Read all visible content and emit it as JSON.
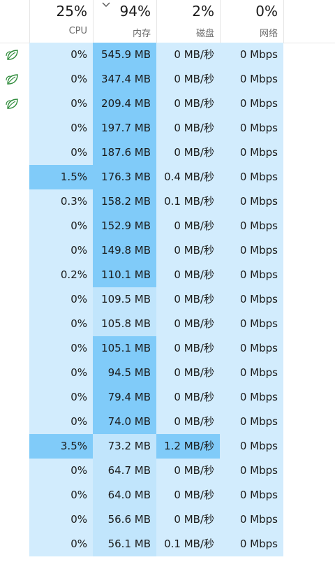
{
  "header": {
    "columns": [
      {
        "percent": "25%",
        "label": "CPU"
      },
      {
        "percent": "94%",
        "label": "内存",
        "sorted": true,
        "sort_icon": "chevron-down-icon"
      },
      {
        "percent": "2%",
        "label": "磁盘"
      },
      {
        "percent": "0%",
        "label": "网络"
      }
    ]
  },
  "heat_colors": {
    "l1": "#d2ecfd",
    "l2": "#c1e5fc",
    "l3": "#9cd6fb",
    "l4": "#80cbf9"
  },
  "rows": [
    {
      "efficiency_icon": "leaf-icon",
      "cpu": "0%",
      "cpu_lvl": "l1",
      "mem": "545.9 MB",
      "mem_lvl": "l4",
      "disk": "0 MB/秒",
      "disk_lvl": "l1",
      "net": "0 Mbps",
      "net_lvl": "l1"
    },
    {
      "efficiency_icon": "leaf-icon",
      "cpu": "0%",
      "cpu_lvl": "l1",
      "mem": "347.4 MB",
      "mem_lvl": "l4",
      "disk": "0 MB/秒",
      "disk_lvl": "l1",
      "net": "0 Mbps",
      "net_lvl": "l1"
    },
    {
      "efficiency_icon": "leaf-icon",
      "cpu": "0%",
      "cpu_lvl": "l1",
      "mem": "209.4 MB",
      "mem_lvl": "l4",
      "disk": "0 MB/秒",
      "disk_lvl": "l1",
      "net": "0 Mbps",
      "net_lvl": "l1"
    },
    {
      "cpu": "0%",
      "cpu_lvl": "l1",
      "mem": "197.7 MB",
      "mem_lvl": "l4",
      "disk": "0 MB/秒",
      "disk_lvl": "l1",
      "net": "0 Mbps",
      "net_lvl": "l1"
    },
    {
      "cpu": "0%",
      "cpu_lvl": "l1",
      "mem": "187.6 MB",
      "mem_lvl": "l4",
      "disk": "0 MB/秒",
      "disk_lvl": "l1",
      "net": "0 Mbps",
      "net_lvl": "l1"
    },
    {
      "cpu": "1.5%",
      "cpu_lvl": "l4",
      "mem": "176.3 MB",
      "mem_lvl": "l4",
      "disk": "0.4 MB/秒",
      "disk_lvl": "l1",
      "net": "0 Mbps",
      "net_lvl": "l1"
    },
    {
      "cpu": "0.3%",
      "cpu_lvl": "l1",
      "mem": "158.2 MB",
      "mem_lvl": "l4",
      "disk": "0.1 MB/秒",
      "disk_lvl": "l1",
      "net": "0 Mbps",
      "net_lvl": "l1"
    },
    {
      "cpu": "0%",
      "cpu_lvl": "l1",
      "mem": "152.9 MB",
      "mem_lvl": "l4",
      "disk": "0 MB/秒",
      "disk_lvl": "l1",
      "net": "0 Mbps",
      "net_lvl": "l1"
    },
    {
      "cpu": "0%",
      "cpu_lvl": "l1",
      "mem": "149.8 MB",
      "mem_lvl": "l4",
      "disk": "0 MB/秒",
      "disk_lvl": "l1",
      "net": "0 Mbps",
      "net_lvl": "l1"
    },
    {
      "cpu": "0.2%",
      "cpu_lvl": "l1",
      "mem": "110.1 MB",
      "mem_lvl": "l4",
      "disk": "0 MB/秒",
      "disk_lvl": "l1",
      "net": "0 Mbps",
      "net_lvl": "l1"
    },
    {
      "cpu": "0%",
      "cpu_lvl": "l1",
      "mem": "109.5 MB",
      "mem_lvl": "l2",
      "disk": "0 MB/秒",
      "disk_lvl": "l1",
      "net": "0 Mbps",
      "net_lvl": "l1"
    },
    {
      "cpu": "0%",
      "cpu_lvl": "l1",
      "mem": "105.8 MB",
      "mem_lvl": "l2",
      "disk": "0 MB/秒",
      "disk_lvl": "l1",
      "net": "0 Mbps",
      "net_lvl": "l1"
    },
    {
      "cpu": "0%",
      "cpu_lvl": "l1",
      "mem": "105.1 MB",
      "mem_lvl": "l4",
      "disk": "0 MB/秒",
      "disk_lvl": "l1",
      "net": "0 Mbps",
      "net_lvl": "l1"
    },
    {
      "cpu": "0%",
      "cpu_lvl": "l1",
      "mem": "94.5 MB",
      "mem_lvl": "l4",
      "disk": "0 MB/秒",
      "disk_lvl": "l1",
      "net": "0 Mbps",
      "net_lvl": "l1"
    },
    {
      "cpu": "0%",
      "cpu_lvl": "l1",
      "mem": "79.4 MB",
      "mem_lvl": "l4",
      "disk": "0 MB/秒",
      "disk_lvl": "l1",
      "net": "0 Mbps",
      "net_lvl": "l1"
    },
    {
      "cpu": "0%",
      "cpu_lvl": "l1",
      "mem": "74.0 MB",
      "mem_lvl": "l4",
      "disk": "0 MB/秒",
      "disk_lvl": "l1",
      "net": "0 Mbps",
      "net_lvl": "l1"
    },
    {
      "cpu": "3.5%",
      "cpu_lvl": "l4",
      "mem": "73.2 MB",
      "mem_lvl": "l2",
      "disk": "1.2 MB/秒",
      "disk_lvl": "l4",
      "net": "0 Mbps",
      "net_lvl": "l1"
    },
    {
      "cpu": "0%",
      "cpu_lvl": "l1",
      "mem": "64.7 MB",
      "mem_lvl": "l2",
      "disk": "0 MB/秒",
      "disk_lvl": "l1",
      "net": "0 Mbps",
      "net_lvl": "l1"
    },
    {
      "cpu": "0%",
      "cpu_lvl": "l1",
      "mem": "64.0 MB",
      "mem_lvl": "l2",
      "disk": "0 MB/秒",
      "disk_lvl": "l1",
      "net": "0 Mbps",
      "net_lvl": "l1"
    },
    {
      "cpu": "0%",
      "cpu_lvl": "l1",
      "mem": "56.6 MB",
      "mem_lvl": "l2",
      "disk": "0 MB/秒",
      "disk_lvl": "l1",
      "net": "0 Mbps",
      "net_lvl": "l1"
    },
    {
      "cpu": "0%",
      "cpu_lvl": "l1",
      "mem": "56.1 MB",
      "mem_lvl": "l2",
      "disk": "0.1 MB/秒",
      "disk_lvl": "l1",
      "net": "0 Mbps",
      "net_lvl": "l1"
    }
  ]
}
